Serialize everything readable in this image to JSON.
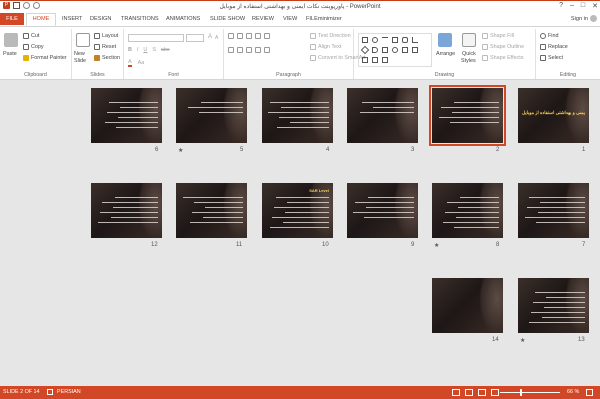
{
  "window": {
    "title": "پاورپوینت نکات ایمنی و بهداشتی استفاده از موبایل - PowerPoint",
    "signin": "Sign in",
    "controls": [
      "?",
      "–",
      "□",
      "✕"
    ]
  },
  "tabs": [
    "FILE",
    "HOME",
    "INSERT",
    "DESIGN",
    "TRANSITIONS",
    "ANIMATIONS",
    "SLIDE SHOW",
    "REVIEW",
    "VIEW",
    "FILEminimizer"
  ],
  "ribbon": {
    "clipboard": {
      "label": "Clipboard",
      "paste": "Paste",
      "cut": "Cut",
      "copy": "Copy",
      "format_painter": "Format Painter"
    },
    "slides": {
      "label": "Slides",
      "new_slide": "New",
      "new_slide2": "Slide",
      "layout": "Layout",
      "reset": "Reset",
      "section": "Section"
    },
    "font": {
      "label": "Font"
    },
    "paragraph": {
      "label": "Paragraph",
      "text_direction": "Text Direction",
      "align_text": "Align Text",
      "convert": "Convert to SmartArt"
    },
    "drawing": {
      "label": "Drawing",
      "arrange": "Arrange",
      "quick_styles": "Quick",
      "quick_styles2": "Styles",
      "shape_fill": "Shape Fill",
      "shape_outline": "Shape Outline",
      "shape_effects": "Shape Effects"
    },
    "editing": {
      "label": "Editing",
      "find": "Find",
      "replace": "Replace",
      "select": "Select"
    }
  },
  "slides": [
    {
      "num": "1",
      "title": "",
      "big_title": "نکات ایمنی و بهداشتی استفاده از موبایل",
      "lines": 0,
      "star": false,
      "selected": false
    },
    {
      "num": "2",
      "title": "",
      "big_title": "",
      "lines": 5,
      "star": false,
      "selected": true
    },
    {
      "num": "3",
      "title": "",
      "big_title": "",
      "lines": 3,
      "star": false,
      "selected": false
    },
    {
      "num": "4",
      "title": "",
      "big_title": "",
      "lines": 6,
      "star": false,
      "selected": false
    },
    {
      "num": "5",
      "title": "",
      "big_title": "",
      "lines": 3,
      "star": true,
      "selected": false
    },
    {
      "num": "6",
      "title": "",
      "big_title": "",
      "lines": 6,
      "star": false,
      "selected": false
    },
    {
      "num": "7",
      "title": "",
      "big_title": "",
      "lines": 6,
      "star": false,
      "selected": false
    },
    {
      "num": "8",
      "title": "",
      "big_title": "",
      "lines": 7,
      "star": true,
      "selected": false
    },
    {
      "num": "9",
      "title": "",
      "big_title": "",
      "lines": 5,
      "star": false,
      "selected": false
    },
    {
      "num": "10",
      "title": "SAR Level",
      "big_title": "",
      "lines": 7,
      "star": false,
      "selected": false
    },
    {
      "num": "11",
      "title": "",
      "big_title": "",
      "lines": 6,
      "star": false,
      "selected": false
    },
    {
      "num": "12",
      "title": "",
      "big_title": "",
      "lines": 6,
      "star": false,
      "selected": false
    },
    {
      "num": "13",
      "title": "",
      "big_title": "",
      "lines": 7,
      "star": true,
      "selected": false
    },
    {
      "num": "14",
      "title": "",
      "big_title": "",
      "lines": 0,
      "star": false,
      "selected": false
    }
  ],
  "status": {
    "slide": "SLIDE 2 OF 14",
    "language": "PERSIAN",
    "zoom": "66 %"
  },
  "colors": {
    "accent": "#d24726",
    "slide_title": "#ffd34d"
  }
}
